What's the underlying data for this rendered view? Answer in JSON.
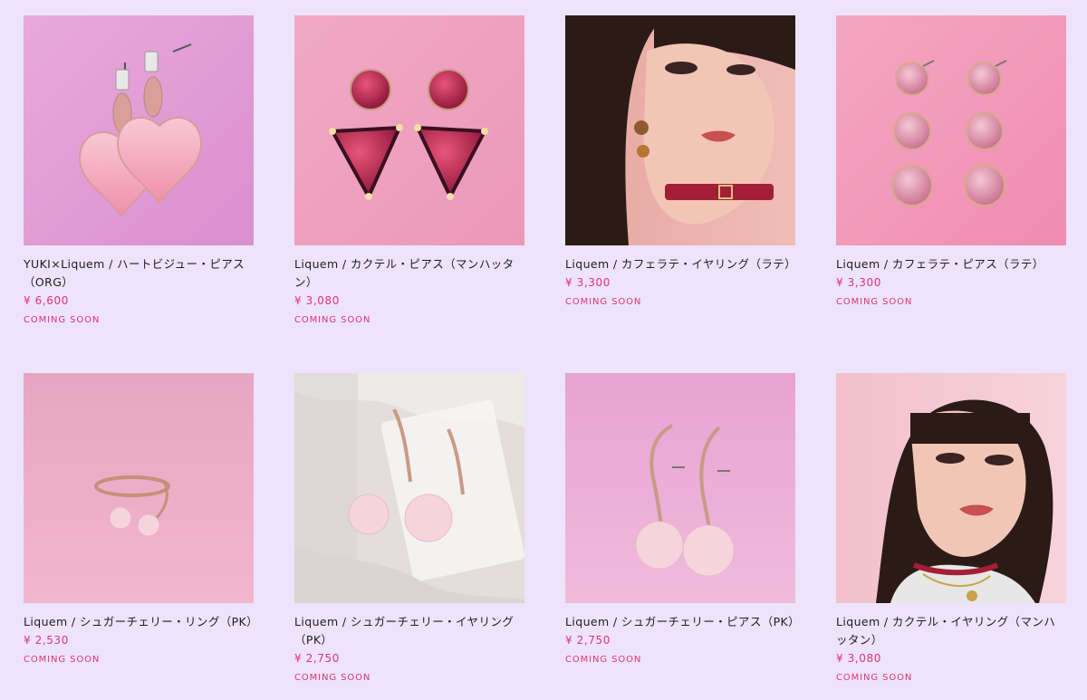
{
  "colors": {
    "page_background": "#EDE3FB",
    "price": "#E0337D",
    "status": "#E0337D"
  },
  "products": [
    {
      "name": "YUKI×Liquem / ハートビジュー・ピアス（ORG）",
      "price": "¥ 6,600",
      "status": "COMING SOON",
      "image_icon": "heart-earrings-image"
    },
    {
      "name": "Liquem / カクテル・ピアス（マンハッタン）",
      "price": "¥ 3,080",
      "status": "COMING SOON",
      "image_icon": "cocktail-earrings-image"
    },
    {
      "name": "Liquem / カフェラテ・イヤリング（ラテ）",
      "price": "¥ 3,300",
      "status": "COMING SOON",
      "image_icon": "model-portrait-image"
    },
    {
      "name": "Liquem / カフェラテ・ピアス（ラテ）",
      "price": "¥ 3,300",
      "status": "COMING SOON",
      "image_icon": "cafe-latte-earrings-image"
    },
    {
      "name": "Liquem / シュガーチェリー・リング（PK）",
      "price": "¥ 2,530",
      "status": "COMING SOON",
      "image_icon": "cherry-ring-image"
    },
    {
      "name": "Liquem / シュガーチェリー・イヤリング（PK）",
      "price": "¥ 2,750",
      "status": "COMING SOON",
      "image_icon": "cherry-earrings-packaging-image"
    },
    {
      "name": "Liquem / シュガーチェリー・ピアス（PK）",
      "price": "¥ 2,750",
      "status": "COMING SOON",
      "image_icon": "cherry-earrings-image"
    },
    {
      "name": "Liquem / カクテル・イヤリング（マンハッタン）",
      "price": "¥ 3,080",
      "status": "COMING SOON",
      "image_icon": "model-portrait-image"
    }
  ]
}
